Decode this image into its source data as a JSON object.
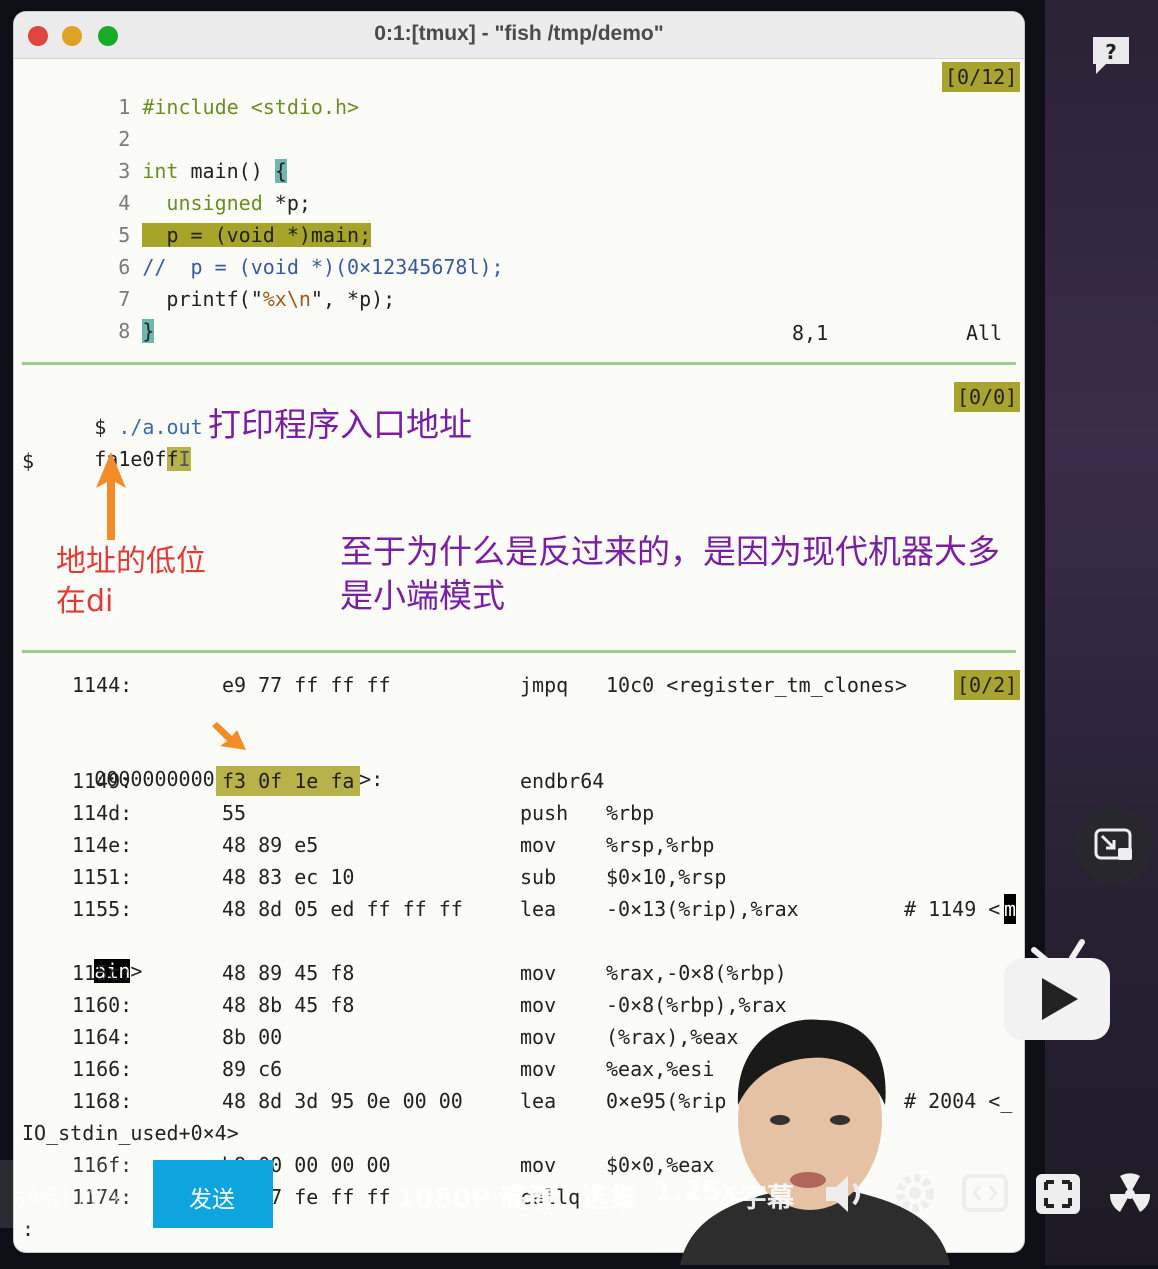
{
  "window": {
    "title": "0:1:[tmux] - \"fish /tmp/demo\"",
    "traffic_colors": [
      "#ff5f57",
      "#febc2e",
      "#28c840"
    ]
  },
  "editor": {
    "position_badge": "[0/12]",
    "lines": [
      {
        "num": "1",
        "text": "#include <stdio.h>"
      },
      {
        "num": "2",
        "text": ""
      },
      {
        "num": "3",
        "kw": "int",
        "text": " main() ",
        "brace": "{"
      },
      {
        "num": "4",
        "kw": "unsigned",
        "text": " *p;",
        "indent": "  "
      },
      {
        "num": "5",
        "text": "p = (void *)main;",
        "indent": "  "
      },
      {
        "num": "6",
        "text": "//  p = (void *)(0×12345678l);"
      },
      {
        "num": "7",
        "text_before": "printf(\"",
        "fmt": "%x\\n",
        "text_after": "\", *p);",
        "indent": "  "
      },
      {
        "num": "8",
        "brace": "}"
      }
    ],
    "status_pos": "8,1",
    "status_scroll": "All"
  },
  "shell": {
    "badge": "[0/0]",
    "prompt1": "$ ",
    "command": "./a.out",
    "output_a": "fa1e0f",
    "output_b": "f",
    "output_cursor": "I",
    "prompt2": "$"
  },
  "annotations": {
    "entry": "打印程序入口地址",
    "low_line1": "地址的低位",
    "low_line2": "在di",
    "endian_line1": "至于为什么是反过来的，是因为现代机器大多",
    "endian_line2": "是小端模式"
  },
  "disasm": {
    "badge": "[0/2]",
    "first": {
      "addr": "1144:",
      "bytes": "e9 77 ff ff ff",
      "op": "jmpq",
      "args": "10c0 <register_tm_clones>"
    },
    "label_addr": "0000000000001149 <",
    "label_name": "main",
    "label_end": ">:",
    "rows": [
      {
        "addr": "1149:",
        "bytes": "f3 0f 1e fa",
        "op": "endbr64",
        "args": ""
      },
      {
        "addr": "114d:",
        "bytes": "55",
        "op": "push",
        "args": "%rbp"
      },
      {
        "addr": "114e:",
        "bytes": "48 89 e5",
        "op": "mov",
        "args": "%rsp,%rbp"
      },
      {
        "addr": "1151:",
        "bytes": "48 83 ec 10",
        "op": "sub",
        "args": "$0×10,%rsp"
      },
      {
        "addr": "1155:",
        "bytes": "48 8d 05 ed ff ff ff",
        "op": "lea",
        "args": "-0×13(%rip),%rax",
        "comment": "# 1149 <",
        "cursor": "m"
      }
    ],
    "wrap1_inv": "ain",
    "wrap1_end": ">",
    "rows2": [
      {
        "addr": "115c:",
        "bytes": "48 89 45 f8",
        "op": "mov",
        "args": "%rax,-0×8(%rbp)"
      },
      {
        "addr": "1160:",
        "bytes": "48 8b 45 f8",
        "op": "mov",
        "args": "-0×8(%rbp),%rax"
      },
      {
        "addr": "1164:",
        "bytes": "8b 00",
        "op": "mov",
        "args": "(%rax),%eax"
      },
      {
        "addr": "1166:",
        "bytes": "89 c6",
        "op": "mov",
        "args": "%eax,%esi"
      },
      {
        "addr": "1168:",
        "bytes": "48 8d 3d 95 0e 00 00",
        "op": "lea",
        "args": "0×e95(%rip",
        "comment": "# 2004 <_"
      }
    ],
    "wrap2": "IO_stdin_used+0×4>",
    "rows3": [
      {
        "addr": "116f:",
        "bytes": "b8 00 00 00 00",
        "op": "mov",
        "args": "$0×0,%eax"
      },
      {
        "addr": "1174:",
        "bytes": "e8 d7 fe ff ff",
        "op": "callq",
        "args": ""
      }
    ],
    "pager": ":"
  },
  "player": {
    "danmaku_placeholder": "弹幕礼仪 ›",
    "send_label": "发送",
    "quality": "1080P 高清",
    "episodes": "选集",
    "speed": "1.25x",
    "subtitle": "字幕"
  },
  "side_icons": [
    "help-icon",
    "picture-in-picture-icon",
    "tv-play-icon"
  ]
}
